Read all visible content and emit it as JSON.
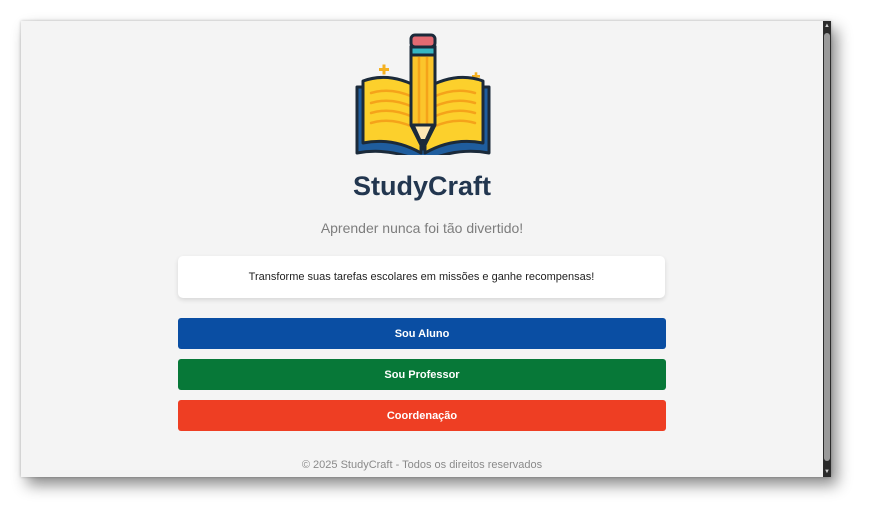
{
  "app": {
    "title": "StudyCraft",
    "subtitle": "Aprender nunca foi tão divertido!",
    "tagline": "Transforme suas tarefas escolares em missões e ganhe recompensas!",
    "logo_icon": "book-pencil-icon"
  },
  "buttons": {
    "aluno_label": "Sou Aluno",
    "professor_label": "Sou Professor",
    "coordenacao_label": "Coordenação"
  },
  "footer": {
    "text": "© 2025 StudyCraft - Todos os direitos reservados"
  },
  "colors": {
    "aluno": "#0a4ea3",
    "professor": "#077838",
    "coordenacao": "#ee3e23",
    "title": "#22364f",
    "background": "#f4f4f4"
  },
  "scrollbar": {
    "up_icon": "scroll-up-arrow-icon",
    "down_icon": "scroll-down-arrow-icon"
  }
}
